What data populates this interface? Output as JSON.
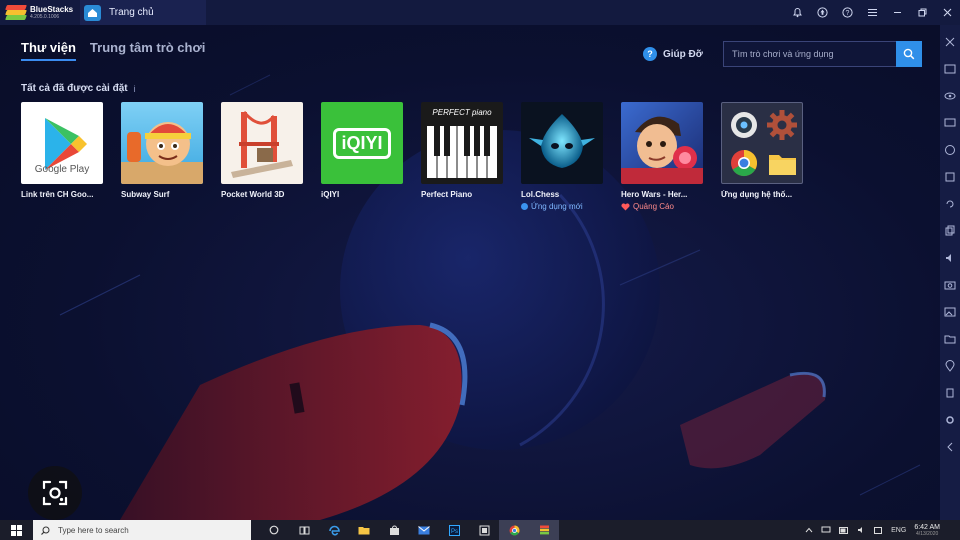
{
  "titlebar": {
    "brand_name": "BlueStacks",
    "brand_version": "4.205.0.1006",
    "home_tab_label": "Trang chủ",
    "icons": [
      "bell-icon",
      "account-icon",
      "help-icon",
      "menu-icon",
      "minimize-icon",
      "restore-icon",
      "close-icon"
    ]
  },
  "main": {
    "tabs": [
      {
        "label": "Thư viện",
        "active": true
      },
      {
        "label": "Trung tâm trò chơi",
        "active": false
      }
    ],
    "help_label": "Giúp Đỡ",
    "search_placeholder": "Tìm trò chơi và ứng dụng",
    "section_title": "Tất cả đã được cài đặt",
    "section_info": "i",
    "apps": [
      {
        "name": "Link trên CH Goo...",
        "icon": "google-play-icon"
      },
      {
        "name": "Subway Surf",
        "icon": "subway-surf-icon"
      },
      {
        "name": "Pocket World 3D",
        "icon": "pocket-world-icon"
      },
      {
        "name": "iQIYI",
        "icon": "iqiyi-icon",
        "icon_text": "iQIYI"
      },
      {
        "name": "Perfect Piano",
        "icon": "piano-icon",
        "icon_text": "PERFECT piano"
      },
      {
        "name": "Lol.Chess",
        "icon": "lol-chess-icon",
        "note": "Ứng dụng mới",
        "note_type": "new"
      },
      {
        "name": "Hero Wars - Her...",
        "icon": "hero-wars-icon",
        "note": "Quảng Cáo",
        "note_type": "ad"
      },
      {
        "name": "Ứng dụng hệ thố...",
        "icon": "system-apps-icon"
      }
    ]
  },
  "google_play_text": "Google Play",
  "taskbar": {
    "search_placeholder": "Type here to search",
    "lang": "ENG",
    "time": "6:42 AM",
    "date": "4/13/2020"
  },
  "colors": {
    "accent": "#2f8fe9",
    "background": "#0b1030",
    "titlebar": "#131a3f"
  }
}
